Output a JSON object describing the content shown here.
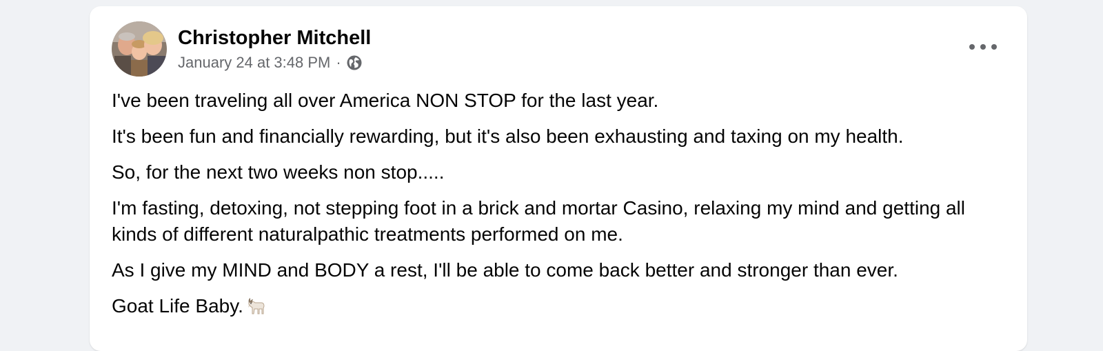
{
  "post": {
    "author": "Christopher Mitchell",
    "timestamp": "January 24 at 3:48 PM",
    "separator": "·",
    "audience_icon": "globe-icon",
    "more_icon": "more-options-icon",
    "paragraphs": [
      "I've been traveling all over America NON STOP for the last year.",
      "It's been fun and financially rewarding, but it's also been exhausting and taxing on my health.",
      "So, for the next two weeks non stop.....",
      "I'm fasting, detoxing, not stepping foot in a brick and mortar Casino, relaxing my mind and getting all kinds of different naturalpathic treatments performed on me.",
      "As I give my MIND and BODY a rest, I'll be able to come back better and stronger than ever.",
      "Goat Life Baby."
    ],
    "trailing_emoji": "goat-emoji-icon"
  },
  "colors": {
    "page_bg": "#f0f2f5",
    "card_bg": "#ffffff",
    "primary_text": "#050505",
    "secondary_text": "#65676b"
  }
}
